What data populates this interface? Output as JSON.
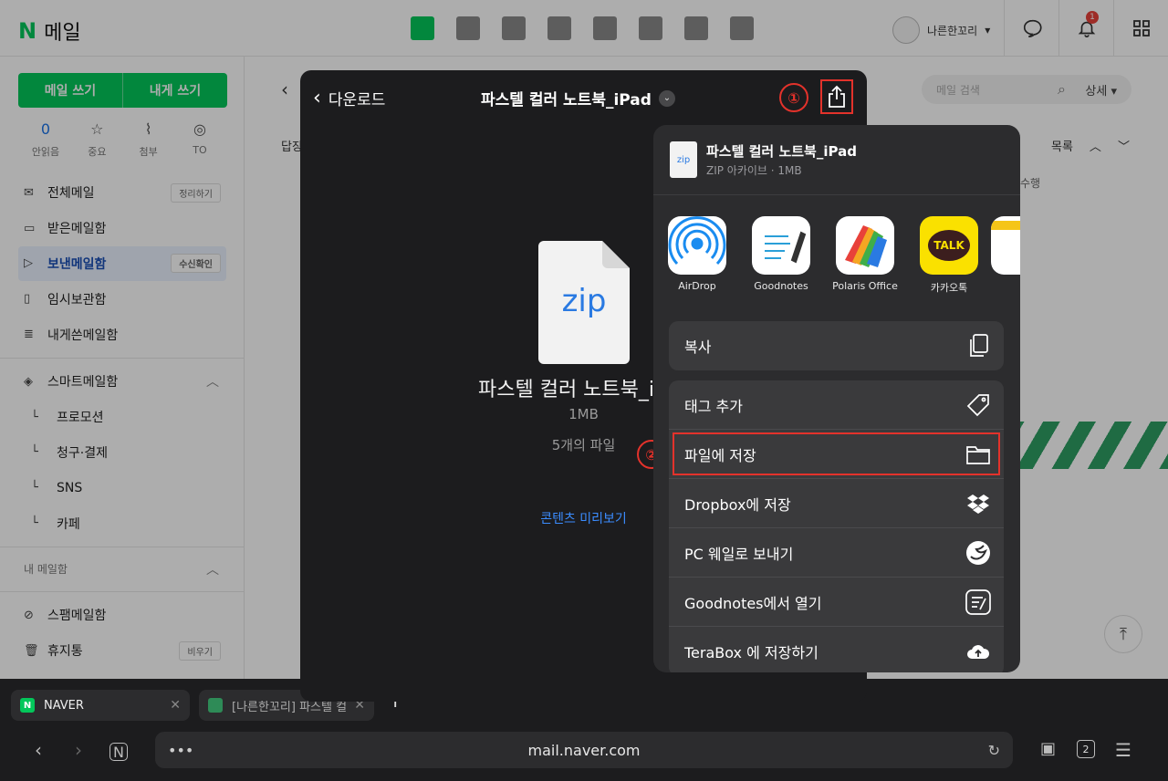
{
  "mail": {
    "brand": "메일",
    "user_name": "나른한꼬리",
    "notification_count": "1",
    "compose_label": "메일 쓰기",
    "self_compose_label": "내게 쓰기",
    "quick": [
      {
        "value": "0",
        "label": "안읽음"
      },
      {
        "icon": "star-icon",
        "label": "중요"
      },
      {
        "icon": "paperclip-icon",
        "label": "첨부"
      },
      {
        "icon": "to-icon",
        "label": "TO"
      }
    ],
    "folders": [
      {
        "label": "전체메일",
        "action": "정리하기"
      },
      {
        "label": "받은메일함"
      },
      {
        "label": "보낸메일함",
        "action": "수신확인",
        "active": true
      },
      {
        "label": "임시보관함"
      },
      {
        "label": "내게쓴메일함"
      }
    ],
    "smart_section": "스마트메일함",
    "smart_items": [
      "프로모션",
      "청구·결제",
      "SNS",
      "카페"
    ],
    "my_section": "내 메일함",
    "bottom_folders": [
      {
        "label": "스팸메일함"
      },
      {
        "label": "휴지통",
        "action": "비우기"
      }
    ],
    "search_placeholder": "메일 검색",
    "search_detail": "상세 ▾",
    "list_label": "목록",
    "partial_reply": "답장",
    "partial_hint": "수행"
  },
  "viewer": {
    "back_label": "다운로드",
    "title": "파스텔 컬러 노트북_iPad",
    "file_type_label": "zip",
    "file_name": "파스텔 컬러 노트북_i",
    "size": "1MB",
    "file_count": "5개의 파일",
    "preview_link": "콘텐츠 미리보기",
    "step1": "①",
    "step2": "②"
  },
  "share_sheet": {
    "file_name": "파스텔 컬러 노트북_iPad",
    "file_meta": "ZIP 아카이브 · 1MB",
    "file_icon_label": "zip",
    "apps": [
      {
        "label": "AirDrop",
        "icon": "airdrop-icon"
      },
      {
        "label": "Goodnotes",
        "icon": "goodnotes-icon"
      },
      {
        "label": "Polaris Office",
        "icon": "polaris-office-icon"
      },
      {
        "label": "카카오톡",
        "icon": "kakaotalk-icon",
        "icon_text": "TALK"
      }
    ],
    "copy_label": "복사",
    "actions": [
      {
        "label": "태그 추가",
        "icon": "tag-icon"
      },
      {
        "label": "파일에 저장",
        "icon": "folder-icon",
        "highlighted": true
      },
      {
        "label": "Dropbox에 저장",
        "icon": "dropbox-icon"
      },
      {
        "label": "PC 웨일로 보내기",
        "icon": "whale-icon"
      },
      {
        "label": "Goodnotes에서 열기",
        "icon": "goodnotes-open-icon"
      },
      {
        "label": "TeraBox 에 저장하기",
        "icon": "cloud-upload-icon"
      }
    ]
  },
  "browser": {
    "tabs": [
      {
        "title": "NAVER",
        "icon_text": "N"
      },
      {
        "title": "[나른한꼬리] 파스텔 컬"
      }
    ],
    "url": "mail.naver.com",
    "tab_count": "2"
  },
  "colors": {
    "naver_green": "#03c75a",
    "annotation_red": "#e3322b",
    "link_blue": "#3b8cff"
  }
}
